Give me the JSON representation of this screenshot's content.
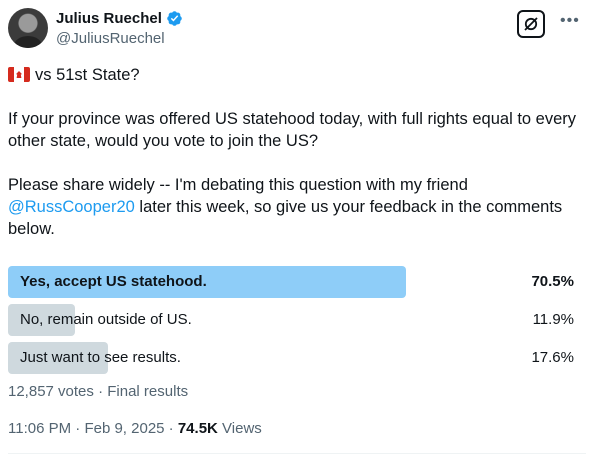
{
  "author": {
    "display_name": "Julius Ruechel",
    "handle": "@JuliusRuechel",
    "verified": true
  },
  "tweet": {
    "line1": "vs 51st State?",
    "line1_emoji": "canada-flag",
    "paragraph2": "If your province was offered US statehood today, with full rights equal to every other state, would you vote to join the US?",
    "paragraph3_before": "Please share widely -- I'm debating this question with my friend ",
    "mention": "@RussCooper20",
    "paragraph3_after": " later this week,  so give us your feedback in the comments below."
  },
  "poll": {
    "options": [
      {
        "label": "Yes, accept US statehood.",
        "percent_text": "70.5%",
        "percent": 70.5,
        "winner": true
      },
      {
        "label": "No, remain outside of US.",
        "percent_text": "11.9%",
        "percent": 11.9,
        "winner": false
      },
      {
        "label": "Just want to see results.",
        "percent_text": "17.6%",
        "percent": 17.6,
        "winner": false
      }
    ],
    "votes_text": "12,857 votes",
    "separator": " · ",
    "status_text": "Final results"
  },
  "meta": {
    "time": "11:06 PM",
    "separator": " · ",
    "date": "Feb 9, 2025",
    "views_count": "74.5K",
    "views_label": " Views"
  },
  "colors": {
    "accent": "#1d9bf0",
    "winner_bar": "#8ecdf8",
    "other_bar": "#cfd9de",
    "secondary_text": "#536471"
  }
}
